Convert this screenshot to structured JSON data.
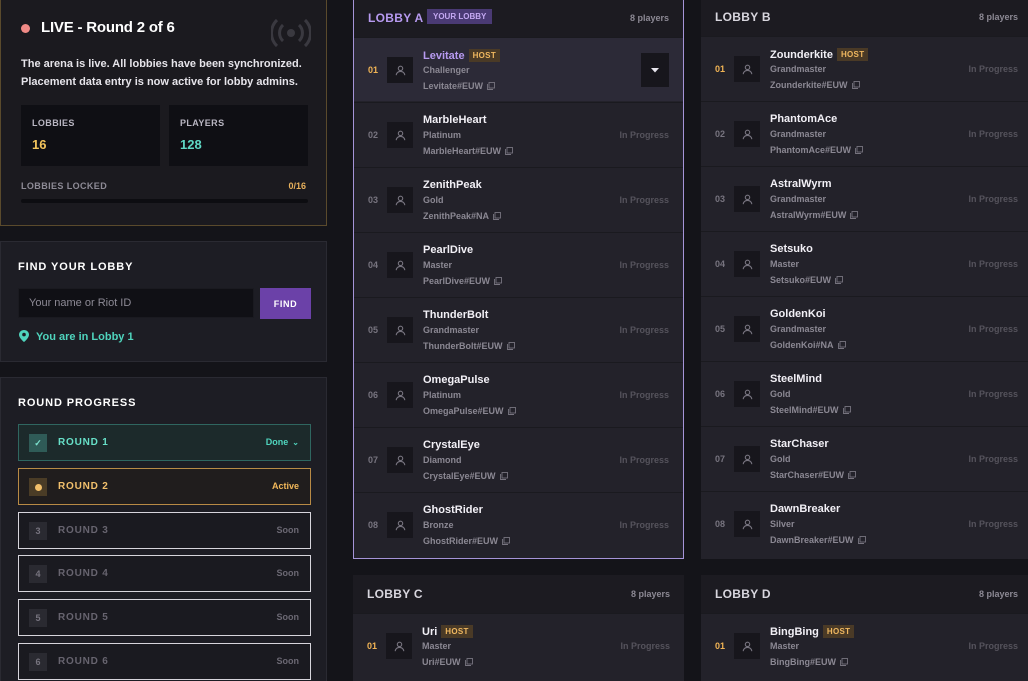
{
  "live": {
    "title": "LIVE - Round 2 of 6",
    "description": "The arena is live. All lobbies have been synchronized. Placement data entry is now active for lobby admins.",
    "stats": [
      {
        "label": "LOBBIES",
        "value": "16",
        "color": "#f2c45c"
      },
      {
        "label": "PLAYERS",
        "value": "128",
        "color": "#5ed8c4"
      }
    ],
    "locked_label": "LOBBIES LOCKED",
    "locked_count": "0/16",
    "locked_fraction": 0
  },
  "find": {
    "title": "FIND YOUR LOBBY",
    "placeholder": "Your name or Riot ID",
    "button_label": "FIND",
    "result": "You are in Lobby 1"
  },
  "progress": {
    "title": "ROUND PROGRESS",
    "rounds": [
      {
        "label": "ROUND 1",
        "status": "Done",
        "state": "done",
        "badge": "✓"
      },
      {
        "label": "ROUND 2",
        "status": "Active",
        "state": "active",
        "badge": ""
      },
      {
        "label": "ROUND 3",
        "status": "Soon",
        "state": "soon",
        "badge": "3"
      },
      {
        "label": "ROUND 4",
        "status": "Soon",
        "state": "soon",
        "badge": "4"
      },
      {
        "label": "ROUND 5",
        "status": "Soon",
        "state": "soon",
        "badge": "5"
      },
      {
        "label": "ROUND 6",
        "status": "Soon",
        "state": "soon",
        "badge": "6"
      }
    ]
  },
  "lobbies": [
    {
      "name": "LOBBY A",
      "badge": "YOUR LOBBY",
      "count": "8 players",
      "players": [
        {
          "seat": "01",
          "name": "Levitate",
          "host": "HOST",
          "rank": "Challenger",
          "riot_id": "Levitate#EUW",
          "status": "",
          "me": true
        },
        {
          "seat": "02",
          "name": "MarbleHeart",
          "host": "",
          "rank": "Platinum",
          "riot_id": "MarbleHeart#EUW",
          "status": "In Progress"
        },
        {
          "seat": "03",
          "name": "ZenithPeak",
          "host": "",
          "rank": "Gold",
          "riot_id": "ZenithPeak#NA",
          "status": "In Progress"
        },
        {
          "seat": "04",
          "name": "PearlDive",
          "host": "",
          "rank": "Master",
          "riot_id": "PearlDive#EUW",
          "status": "In Progress"
        },
        {
          "seat": "05",
          "name": "ThunderBolt",
          "host": "",
          "rank": "Grandmaster",
          "riot_id": "ThunderBolt#EUW",
          "status": "In Progress"
        },
        {
          "seat": "06",
          "name": "OmegaPulse",
          "host": "",
          "rank": "Platinum",
          "riot_id": "OmegaPulse#EUW",
          "status": "In Progress"
        },
        {
          "seat": "07",
          "name": "CrystalEye",
          "host": "",
          "rank": "Diamond",
          "riot_id": "CrystalEye#EUW",
          "status": "In Progress"
        },
        {
          "seat": "08",
          "name": "GhostRider",
          "host": "",
          "rank": "Bronze",
          "riot_id": "GhostRider#EUW",
          "status": "In Progress"
        }
      ]
    },
    {
      "name": "LOBBY B",
      "badge": "",
      "count": "8 players",
      "players": [
        {
          "seat": "01",
          "name": "Zounderkite",
          "host": "HOST",
          "rank": "Grandmaster",
          "riot_id": "Zounderkite#EUW",
          "status": "In Progress"
        },
        {
          "seat": "02",
          "name": "PhantomAce",
          "host": "",
          "rank": "Grandmaster",
          "riot_id": "PhantomAce#EUW",
          "status": "In Progress"
        },
        {
          "seat": "03",
          "name": "AstralWyrm",
          "host": "",
          "rank": "Grandmaster",
          "riot_id": "AstralWyrm#EUW",
          "status": "In Progress"
        },
        {
          "seat": "04",
          "name": "Setsuko",
          "host": "",
          "rank": "Master",
          "riot_id": "Setsuko#EUW",
          "status": "In Progress"
        },
        {
          "seat": "05",
          "name": "GoldenKoi",
          "host": "",
          "rank": "Grandmaster",
          "riot_id": "GoldenKoi#NA",
          "status": "In Progress"
        },
        {
          "seat": "06",
          "name": "SteelMind",
          "host": "",
          "rank": "Gold",
          "riot_id": "SteelMind#EUW",
          "status": "In Progress"
        },
        {
          "seat": "07",
          "name": "StarChaser",
          "host": "",
          "rank": "Gold",
          "riot_id": "StarChaser#EUW",
          "status": "In Progress"
        },
        {
          "seat": "08",
          "name": "DawnBreaker",
          "host": "",
          "rank": "Silver",
          "riot_id": "DawnBreaker#EUW",
          "status": "In Progress"
        }
      ]
    },
    {
      "name": "LOBBY C",
      "badge": "",
      "count": "8 players",
      "players": [
        {
          "seat": "01",
          "name": "Uri",
          "host": "HOST",
          "rank": "Master",
          "riot_id": "Uri#EUW",
          "status": "In Progress"
        }
      ]
    },
    {
      "name": "LOBBY D",
      "badge": "",
      "count": "8 players",
      "players": [
        {
          "seat": "01",
          "name": "BingBing",
          "host": "HOST",
          "rank": "Master",
          "riot_id": "BingBing#EUW",
          "status": "In Progress"
        }
      ]
    }
  ],
  "colors": {
    "accent": "#6b41a8",
    "host": "#f1b455",
    "teal": "#4fd4bd",
    "your_lobby_border": "#a594d8"
  },
  "icons": {
    "live": "live-dot-icon",
    "broadcast": "broadcast-icon",
    "location": "map-pin-icon",
    "check": "check-icon",
    "chevron": "chevron-down-icon",
    "user": "user-icon",
    "copy": "copy-icon"
  }
}
